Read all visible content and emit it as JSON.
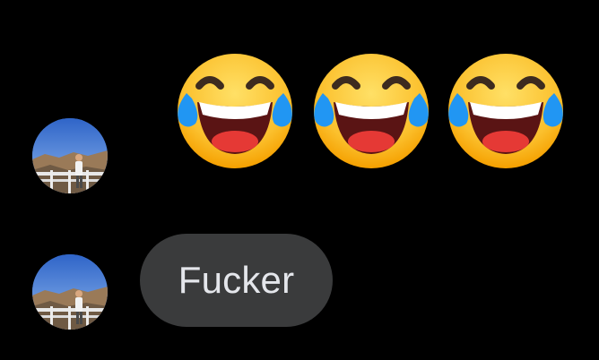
{
  "conversation": {
    "messages": [
      {
        "type": "emoji",
        "emojis": [
          "face-with-tears-of-joy-icon",
          "face-with-tears-of-joy-icon",
          "face-with-tears-of-joy-icon"
        ],
        "sender_avatar": "avatar-photo"
      },
      {
        "type": "text",
        "text": "Fucker",
        "sender_avatar": "avatar-photo"
      }
    ]
  },
  "colors": {
    "background": "#000000",
    "bubble": "#3a3b3c",
    "bubble_text": "#e4e6eb",
    "emoji_face": "#fbc02d",
    "emoji_tear": "#2196f3",
    "emoji_mouth": "#c62828"
  }
}
